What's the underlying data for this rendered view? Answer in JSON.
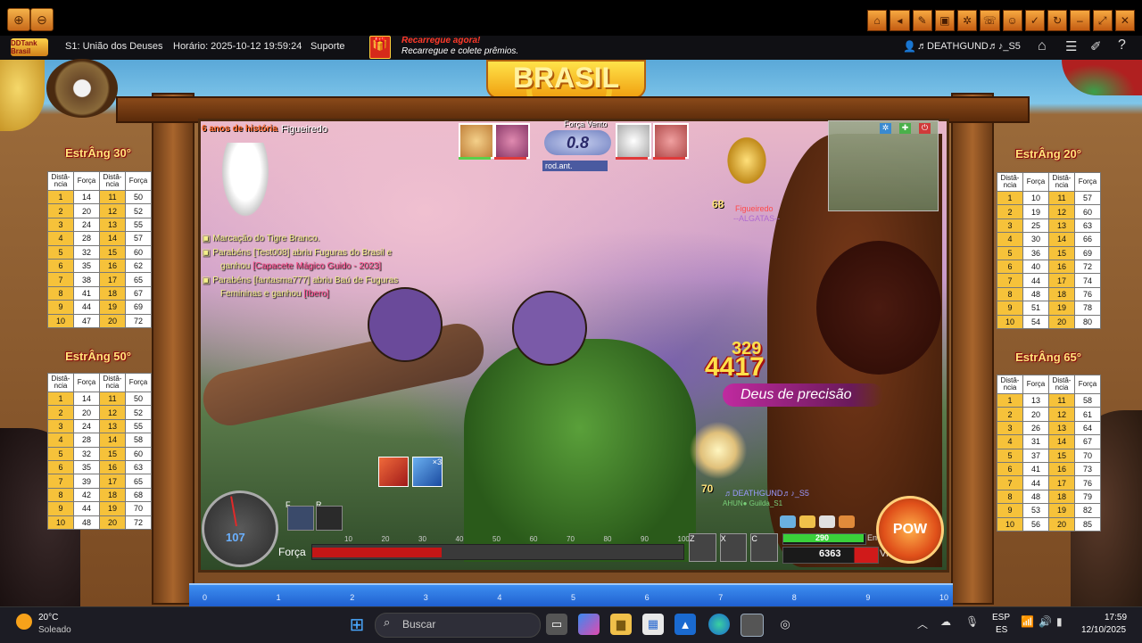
{
  "toolbar": {
    "zoom_in_icon": "zoom-in-icon",
    "zoom_out_icon": "zoom-out-icon",
    "right_icons": [
      "home-icon",
      "arrow-icon",
      "edit-icon",
      "box-icon",
      "gear-icon",
      "chat-icon",
      "person-icon",
      "check-icon",
      "refresh-icon",
      "minimize-icon",
      "expand-icon",
      "close-icon"
    ]
  },
  "header": {
    "logo": "DDTank Brasil",
    "server": "S1: União dos Deuses",
    "time": "Horário: 2025-10-12 19:59:24",
    "support": "Suporte",
    "promo_title": "Recarregue agora!",
    "promo_sub": "Recarregue e colete prêmios.",
    "username": "♬DEATHGUND♬♪_S5"
  },
  "stage": {
    "anniversary": "6 anos de história",
    "player_name": "Figueiredo",
    "wind_label": "Força Vento",
    "wind_value": "0.8",
    "round_label": "rod.ant.",
    "enemy_level": "68",
    "enemy_name": "Figueiredo",
    "enemy_guild": "--ALGATAS--",
    "damage": "4417",
    "damage_sub": "329",
    "skill_banner": "Deus de precisão",
    "player_level": "70",
    "player_tag": "♬DEATHGUND♬♪_S5",
    "player_guild": "AHUN● Guilda_S1",
    "brand": "BRASIL"
  },
  "chat": [
    {
      "text": "Marcação do Tigre Branco.",
      "highlight": ""
    },
    {
      "text": "Parabéns [Test008] abriu Fuguras do Brasil e",
      "highlight": ""
    },
    {
      "text": "ganhou",
      "highlight": "[Capacete Mágico Guido - 2023]"
    },
    {
      "text": "Parabéns [fantasma777] abriu Baú de Fuguras",
      "highlight": ""
    },
    {
      "text": "Femininas  e ganhou",
      "highlight": "[Ibero]"
    }
  ],
  "tables": {
    "t30": {
      "title": "EstrÂng 30°",
      "headers": [
        "Distâ-ncia",
        "Força",
        "Distâ-ncia",
        "Força"
      ],
      "rows": [
        [
          1,
          14,
          11,
          50
        ],
        [
          2,
          20,
          12,
          52
        ],
        [
          3,
          24,
          13,
          55
        ],
        [
          4,
          28,
          14,
          57
        ],
        [
          5,
          32,
          15,
          60
        ],
        [
          6,
          35,
          16,
          62
        ],
        [
          7,
          38,
          17,
          65
        ],
        [
          8,
          41,
          18,
          67
        ],
        [
          9,
          44,
          19,
          69
        ],
        [
          10,
          47,
          20,
          72
        ]
      ]
    },
    "t50": {
      "title": "EstrÂng 50°",
      "headers": [
        "Distâ-ncia",
        "Força",
        "Distâ-ncia",
        "Força"
      ],
      "rows": [
        [
          1,
          14,
          11,
          50
        ],
        [
          2,
          20,
          12,
          52
        ],
        [
          3,
          24,
          13,
          55
        ],
        [
          4,
          28,
          14,
          58
        ],
        [
          5,
          32,
          15,
          60
        ],
        [
          6,
          35,
          16,
          63
        ],
        [
          7,
          39,
          17,
          65
        ],
        [
          8,
          42,
          18,
          68
        ],
        [
          9,
          44,
          19,
          70
        ],
        [
          10,
          48,
          20,
          72
        ]
      ]
    },
    "t20": {
      "title": "EstrÂng 20°",
      "headers": [
        "Distâ-ncia",
        "Força",
        "Distâ-ncia",
        "Força"
      ],
      "rows": [
        [
          1,
          10,
          11,
          57
        ],
        [
          2,
          19,
          12,
          60
        ],
        [
          3,
          25,
          13,
          63
        ],
        [
          4,
          30,
          14,
          66
        ],
        [
          5,
          36,
          15,
          69
        ],
        [
          6,
          40,
          16,
          72
        ],
        [
          7,
          44,
          17,
          74
        ],
        [
          8,
          48,
          18,
          76
        ],
        [
          9,
          51,
          19,
          78
        ],
        [
          10,
          54,
          20,
          80
        ]
      ]
    },
    "t65": {
      "title": "EstrÂng 65°",
      "headers": [
        "Distâ-ncia",
        "Força",
        "Distâ-ncia",
        "Força"
      ],
      "rows": [
        [
          1,
          13,
          11,
          58
        ],
        [
          2,
          20,
          12,
          61
        ],
        [
          3,
          26,
          13,
          64
        ],
        [
          4,
          31,
          14,
          67
        ],
        [
          5,
          37,
          15,
          70
        ],
        [
          6,
          41,
          16,
          73
        ],
        [
          7,
          44,
          17,
          76
        ],
        [
          8,
          48,
          18,
          79
        ],
        [
          9,
          53,
          19,
          82
        ],
        [
          10,
          56,
          20,
          85
        ]
      ]
    }
  },
  "hud": {
    "angle": "107",
    "force_label": "Força",
    "force_ticks": [
      "10",
      "20",
      "30",
      "40",
      "50",
      "60",
      "70",
      "80",
      "90",
      "100"
    ],
    "force_fraction": 0.35,
    "key_f": "F",
    "key_r": "R",
    "skill_keys": [
      "Z",
      "X",
      "C"
    ],
    "energy_label": "Energia",
    "energy_value": "290",
    "life_label": "Vida",
    "life_value": "6363",
    "pow_label": "POW",
    "item_badge": "×3"
  },
  "ruler": [
    "0",
    "1",
    "2",
    "3",
    "4",
    "5",
    "6",
    "7",
    "8",
    "9",
    "10"
  ],
  "taskbar": {
    "temp": "20°C",
    "weather": "Soleado",
    "search_placeholder": "Buscar",
    "lang1": "ESP",
    "lang2": "ES",
    "clock_time": "17:59",
    "clock_date": "12/10/2025"
  }
}
